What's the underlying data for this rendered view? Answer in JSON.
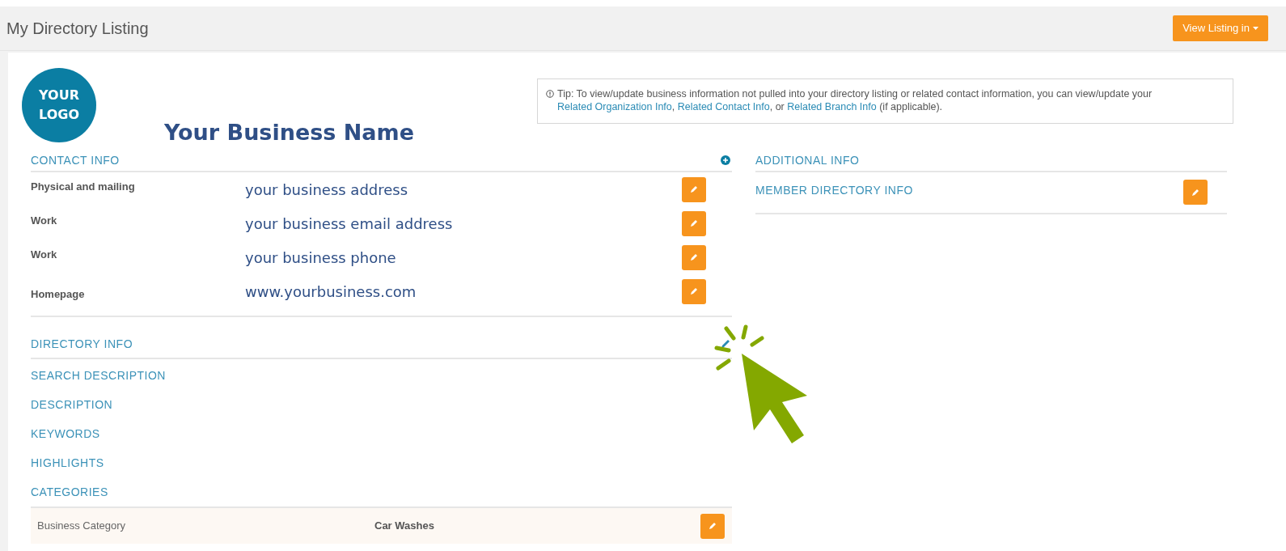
{
  "header": {
    "title": "My Directory Listing",
    "button": "View Listing in"
  },
  "logo": {
    "lines": [
      "YOUR",
      "LOGO"
    ]
  },
  "business_name": "Your Business Name",
  "tip": [
    {
      "kind": "text",
      "text": "Tip: To view/update business information not pulled into your directory listing or related contact information, you can view/update your "
    },
    {
      "kind": "link",
      "text": "Related Organization Info"
    },
    {
      "kind": "text",
      "text": ", "
    },
    {
      "kind": "link",
      "text": "Related Contact Info"
    },
    {
      "kind": "text",
      "text": ", or "
    },
    {
      "kind": "link",
      "text": "Related Branch Info"
    },
    {
      "kind": "text",
      "text": " (if applicable)."
    }
  ],
  "contact_info": {
    "title": "CONTACT INFO",
    "rows": [
      {
        "label": "Physical and mailing",
        "value": "your business address"
      },
      {
        "label": "Work",
        "value": "your business email address"
      },
      {
        "label": "Work",
        "value": "your business phone"
      },
      {
        "label": "Homepage",
        "value": "www.yourbusiness.com"
      }
    ]
  },
  "directory_info": {
    "title": "DIRECTORY INFO",
    "sections": [
      "SEARCH DESCRIPTION",
      "DESCRIPTION",
      "KEYWORDS",
      "HIGHLIGHTS",
      "CATEGORIES"
    ],
    "category_rows": [
      {
        "label": "Business Category",
        "value": "Car Washes"
      }
    ]
  },
  "additional_info": {
    "title": "ADDITIONAL INFO",
    "items": [
      "MEMBER DIRECTORY INFO"
    ]
  }
}
